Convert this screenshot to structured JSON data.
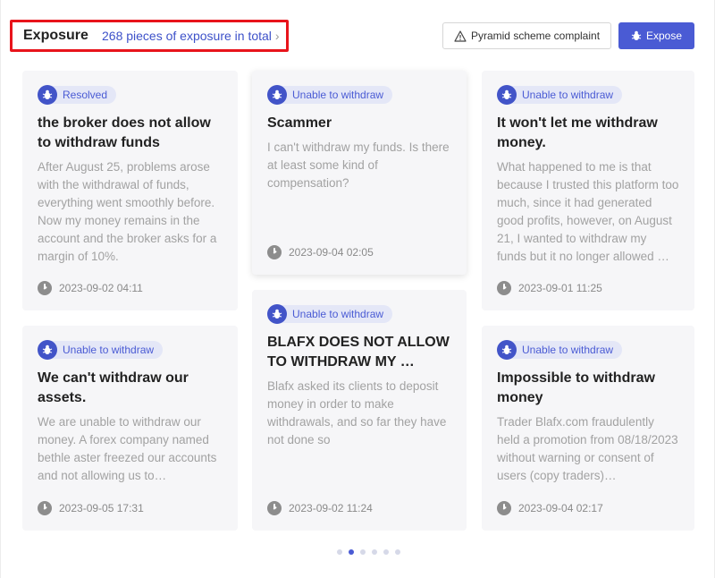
{
  "header": {
    "title": "Exposure",
    "count_link": "268 pieces of exposure in total",
    "complaint_button": "Pyramid scheme complaint",
    "expose_button": "Expose"
  },
  "cards": [
    {
      "tag": "Resolved",
      "title": "the broker does not allow to withdraw funds",
      "text": "After August 25, problems arose with the withdrawal of funds, everything went smoothly before. Now my money remains in the account and the broker asks for a margin of 10%.",
      "date": "2023-09-02 04:11"
    },
    {
      "tag": "Unable to withdraw",
      "title": "Scammer",
      "text": "I can't withdraw my funds. Is there at least some kind of compensation?",
      "date": "2023-09-04 02:05"
    },
    {
      "tag": "Unable to withdraw",
      "title": "It won't let me withdraw money.",
      "text": "What happened to me is that because I trusted this platform too much, since it had generated good profits, however, on August 21, I wanted to withdraw my funds but it no longer allowed …",
      "date": "2023-09-01 11:25"
    },
    {
      "tag": "Unable to withdraw",
      "title": "We can't withdraw our assets.",
      "text": "We are unable to withdraw our money. A forex company named bethle aster freezed our accounts and not allowing us to…",
      "date": "2023-09-05 17:31"
    },
    {
      "tag": "Unable to withdraw",
      "title": "BLAFX DOES NOT ALLOW TO WITHDRAW MY …",
      "text": "Blafx asked its clients to deposit money in order to make withdrawals, and so far they have not done so",
      "date": "2023-09-02 11:24"
    },
    {
      "tag": "Unable to withdraw",
      "title": "Impossible to withdraw money",
      "text": "Trader Blafx.com fraudulently held a promotion from 08/18/2023 without warning or consent of users (copy traders)…",
      "date": "2023-09-04 02:17"
    }
  ],
  "pagination": {
    "total": 6,
    "active": 2
  },
  "colors": {
    "accent": "#4a5bd4",
    "highlight_box": "#e8141b",
    "card_bg": "#f6f6f8"
  },
  "icons": {
    "tag": "bug-icon",
    "date": "clock-icon",
    "complaint": "warning-icon",
    "expose": "bug-icon"
  }
}
